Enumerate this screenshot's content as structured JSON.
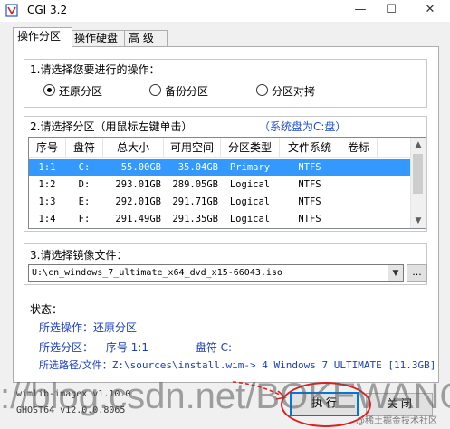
{
  "window": {
    "title": "CGI 3.2"
  },
  "tabs": [
    {
      "label": "操作分区"
    },
    {
      "label": "操作硬盘"
    },
    {
      "label": "高 级"
    }
  ],
  "operation": {
    "title": "1.请选择您要进行的操作：",
    "options": [
      {
        "label": "还原分区",
        "checked": true
      },
      {
        "label": "备份分区",
        "checked": false
      },
      {
        "label": "分区对拷",
        "checked": false
      }
    ]
  },
  "partition": {
    "title": "2.请选择分区（用鼠标左键单击）",
    "system_disk": "（系统盘为C:盘）",
    "columns": [
      "序号",
      "盘符",
      "总大小",
      "可用空间",
      "分区类型",
      "文件系统",
      "卷标"
    ],
    "rows": [
      {
        "idx": "1:1",
        "drive": "C:",
        "total": "55.00GB",
        "free": "35.04GB",
        "type": "Primary",
        "fs": "NTFS",
        "label": ""
      },
      {
        "idx": "1:2",
        "drive": "D:",
        "total": "293.01GB",
        "free": "289.05GB",
        "type": "Logical",
        "fs": "NTFS",
        "label": ""
      },
      {
        "idx": "1:3",
        "drive": "E:",
        "total": "292.01GB",
        "free": "291.71GB",
        "type": "Logical",
        "fs": "NTFS",
        "label": ""
      },
      {
        "idx": "1:4",
        "drive": "F:",
        "total": "291.49GB",
        "free": "291.35GB",
        "type": "Logical",
        "fs": "NTFS",
        "label": ""
      }
    ]
  },
  "image": {
    "title": "3.请选择镜像文件：",
    "path": "U:\\cn_windows_7_ultimate_x64_dvd_x15-66043.iso",
    "browse_label": "..."
  },
  "status": {
    "title": "状态：",
    "operation_label": "所选操作：",
    "operation_value": "还原分区",
    "partition_label": "所选分区：",
    "partition_value": "序号 1:1",
    "drive_label": "盘符 C:",
    "path_label": "所选路径/文件：",
    "path_value": "Z:\\sources\\install.wim-> 4  Windows 7 ULTIMATE [11.3GB]"
  },
  "versions": {
    "line1": "wimlib-imagex v1.10.0",
    "line2": "GHOST64 v12.0.0.8065"
  },
  "buttons": {
    "run": "执 行",
    "close": "关 闭"
  },
  "watermark": {
    "text": "://blog.csdn.net/BOKEWANG",
    "corner": "@稀土掘金技术社区"
  },
  "colors": {
    "accent": "#0078d7",
    "selection": "#3399ff",
    "status_text": "#1a3fbf",
    "annotation": "#e02020"
  }
}
